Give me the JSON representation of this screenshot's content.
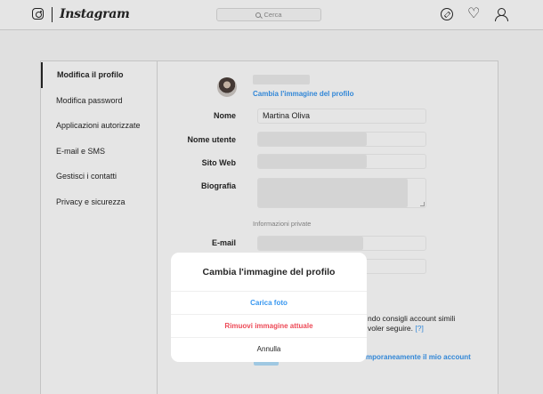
{
  "header": {
    "brand": "Instagram",
    "search_placeholder": "Cerca",
    "icons": [
      "instagram-logo-icon",
      "compass-icon",
      "heart-icon",
      "profile-icon"
    ]
  },
  "sidebar": {
    "items": [
      {
        "label": "Modifica il profilo",
        "active": true
      },
      {
        "label": "Modifica password",
        "active": false
      },
      {
        "label": "Applicazioni autorizzate",
        "active": false
      },
      {
        "label": "E-mail e SMS",
        "active": false
      },
      {
        "label": "Gestisci i contatti",
        "active": false
      },
      {
        "label": "Privacy e sicurezza",
        "active": false
      }
    ]
  },
  "profile": {
    "change_photo_link": "Cambia l'immagine del profilo",
    "fields": {
      "name_label": "Nome",
      "name_value": "Martina Oliva",
      "username_label": "Nome utente",
      "website_label": "Sito Web",
      "bio_label": "Biografia",
      "email_label": "E-mail"
    },
    "private_info_label": "Informazioni private",
    "partial_texts": {
      "suggestions_line1": "ndo consigli account simili",
      "suggestions_line2": "voler seguire.",
      "help_link": "[?]",
      "disable_link": "mporaneamente il mio account"
    }
  },
  "modal": {
    "title": "Cambia l'immagine del profilo",
    "upload_label": "Carica foto",
    "remove_label": "Rimuovi immagine attuale",
    "cancel_label": "Annulla"
  },
  "colors": {
    "accent": "#3897f0",
    "danger": "#ed4956",
    "text": "#262626",
    "border": "#dbdbdb",
    "background": "#fafafa"
  }
}
